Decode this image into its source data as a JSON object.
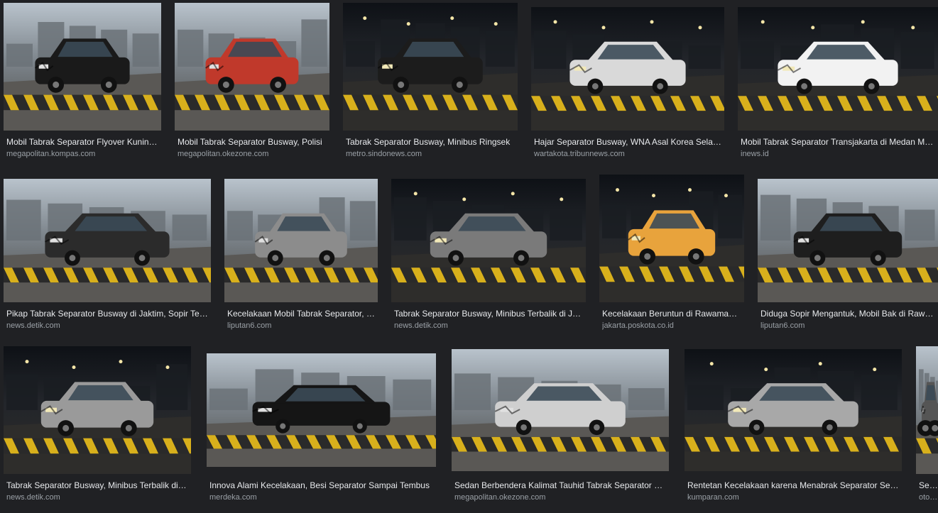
{
  "results": [
    {
      "title": "Mobil Tabrak Separator Flyover Kuningan",
      "source": "megapolitan.kompas.com",
      "scene": "day",
      "vehicle": "#1a1a1a"
    },
    {
      "title": "Mobil Tabrak Separator Busway, Polisi",
      "source": "megapolitan.okezone.com",
      "scene": "day",
      "vehicle": "#c0392b"
    },
    {
      "title": "Tabrak Separator Busway, Minibus Ringsek",
      "source": "metro.sindonews.com",
      "scene": "night",
      "vehicle": "#1c1c1c"
    },
    {
      "title": "Hajar Separator Busway, WNA Asal Korea Selatan",
      "source": "wartakota.tribunnews.com",
      "scene": "night",
      "vehicle": "#d9d9d9"
    },
    {
      "title": "Mobil Tabrak Separator Transjakarta di Medan Merdeka",
      "source": "inews.id",
      "scene": "night",
      "vehicle": "#f2f2f2"
    },
    {
      "title": "Pikap Tabrak Separator Busway di Jaktim, Sopir Tewas",
      "source": "news.detik.com",
      "scene": "day",
      "vehicle": "#2b2b2b"
    },
    {
      "title": "Kecelakaan Mobil Tabrak Separator, Mobil Ringsek",
      "source": "liputan6.com",
      "scene": "day",
      "vehicle": "#8c8c8c"
    },
    {
      "title": "Tabrak Separator Busway, Minibus Terbalik di Jalan",
      "source": "news.detik.com",
      "scene": "night",
      "vehicle": "#7a7a7a"
    },
    {
      "title": "Kecelakaan Beruntun di Rawamangun",
      "source": "jakarta.poskota.co.id",
      "scene": "night",
      "vehicle": "#e8a33c"
    },
    {
      "title": "Diduga Sopir Mengantuk, Mobil Bak di Rawamangun",
      "source": "liputan6.com",
      "scene": "day",
      "vehicle": "#1e1e1e"
    },
    {
      "title": "Tabrak Separator Busway, Minibus Terbalik di Jalan",
      "source": "news.detik.com",
      "scene": "night",
      "vehicle": "#9a9a9a"
    },
    {
      "title": "Innova Alami Kecelakaan, Besi Separator Sampai Tembus",
      "source": "merdeka.com",
      "scene": "day",
      "vehicle": "#151515"
    },
    {
      "title": "Sedan Berbendera Kalimat Tauhid Tabrak Separator Busway",
      "source": "megapolitan.okezone.com",
      "scene": "day",
      "vehicle": "#cfcfcf"
    },
    {
      "title": "Rentetan Kecelakaan karena Menabrak Separator Separator",
      "source": "kumparan.com",
      "scene": "night",
      "vehicle": "#a8a8a8"
    },
    {
      "title": "Separator",
      "source": "otomotif",
      "scene": "day",
      "vehicle": "#555555"
    }
  ]
}
